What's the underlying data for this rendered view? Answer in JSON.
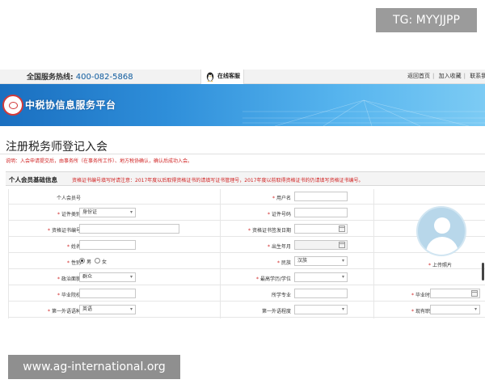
{
  "watermark": {
    "top": "TG: MYYJJPP",
    "bottom": "www.ag-international.org"
  },
  "topbar": {
    "hotline_label": "全国服务热线:",
    "hotline_number": "400-082-5868",
    "online_service": "在线客服",
    "links": [
      "返回首页",
      "加入收藏",
      "联系我"
    ]
  },
  "banner": {
    "brand": "中税协信息服务平台",
    "accent_color": "#2f8fda"
  },
  "page": {
    "title": "注册税务师登记入会",
    "notice": "说明：入会申请提交后，由事务所（在事务所工作）、地方税协确认，确认后成功入会。"
  },
  "section": {
    "title": "个人会员基础信息",
    "warning": "资格证书编号填写时请注意：2017年度以后取得资格证书的请填写证书管理号，2017年度以前取得资格证书的仍请填写资格证书编号。"
  },
  "form": {
    "member_no": {
      "label": "个人会员号"
    },
    "username": {
      "label": "用户名",
      "required": true
    },
    "cert_type": {
      "label": "证件类别",
      "required": true,
      "value": "身份证"
    },
    "cert_no": {
      "label": "证件号码",
      "required": true
    },
    "qual_no": {
      "label": "资格证书编号",
      "required": true
    },
    "qual_date": {
      "label": "资格证书签发日期",
      "required": true
    },
    "name": {
      "label": "姓名",
      "required": true
    },
    "birth": {
      "label": "出生年月",
      "required": true
    },
    "gender": {
      "label": "性别",
      "required": true,
      "options": [
        "男",
        "女"
      ],
      "selected": "男"
    },
    "ethnicity": {
      "label": "民族",
      "required": true,
      "value": "汉族"
    },
    "political": {
      "label": "政治面貌",
      "required": true,
      "value": "群众"
    },
    "education": {
      "label": "最高学历/学位",
      "required": true
    },
    "school": {
      "label": "毕业院校",
      "required": true
    },
    "major": {
      "label": "所学专业"
    },
    "grad_date": {
      "label": "毕业时间",
      "required": true
    },
    "foreign_lang": {
      "label": "第一外语语种",
      "required": true,
      "value": "英语"
    },
    "lang_level": {
      "label": "第一外语程度"
    },
    "title": {
      "label": "现有职称",
      "required": true
    },
    "photo_upload": {
      "label": "上传照片",
      "required": true
    }
  }
}
